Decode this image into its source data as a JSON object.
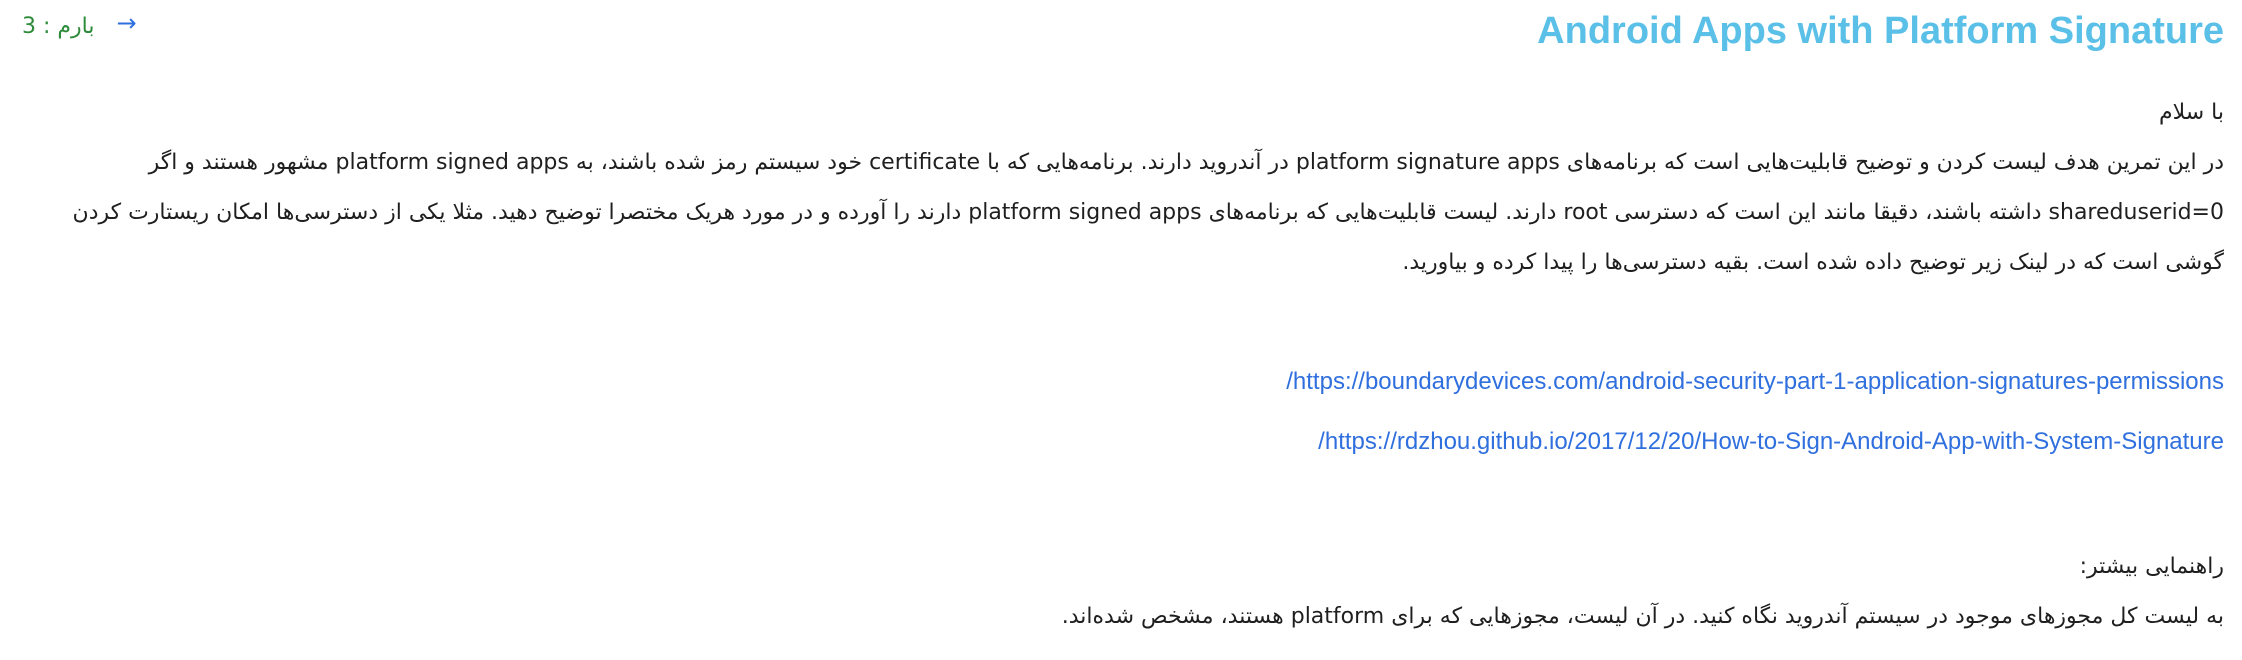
{
  "header": {
    "title": "Android Apps with Platform Signature",
    "load_label": "بارم : 3",
    "arrow_icon": "arrow-right-icon"
  },
  "body": {
    "greeting": "با سلام",
    "paragraph": "در این تمرین هدف لیست کردن و توضیح قابلیت‌هایی است که برنامه‌های platform signature apps در آندروید دارند. برنامه‌هایی که با certificate خود سیستم رمز شده باشند، به platform signed apps مشهور هستند و اگر shareduserid=0 داشته باشند، دقیقا مانند این است که دسترسی root دارند. لیست قابلیت‌هایی که برنامه‌های platform signed apps دارند را آورده و در مورد هریک مختصرا توضیح دهید. مثلا یکی از دسترسی‌ها امکان ریستارت کردن گوشی است که در لینک زیر توضیح داده شده است. بقیه دسترسی‌ها را پیدا کرده و بیاورید.",
    "links": [
      "https://boundarydevices.com/android-security-part-1-application-signatures-permissions/",
      "https://rdzhou.github.io/2017/12/20/How-to-Sign-Android-App-with-System-Signature/"
    ],
    "guide_heading": "راهنمایی بیشتر:",
    "guide_text": "به لیست کل مجوزهای موجود در سیستم آندروید نگاه کنید. در آن لیست، مجوزهایی که برای platform هستند، مشخص شده‌اند."
  },
  "colors": {
    "title": "#5bc0e8",
    "link": "#2f6fde",
    "load": "#2e8b3a",
    "text": "#1f1f1f"
  }
}
